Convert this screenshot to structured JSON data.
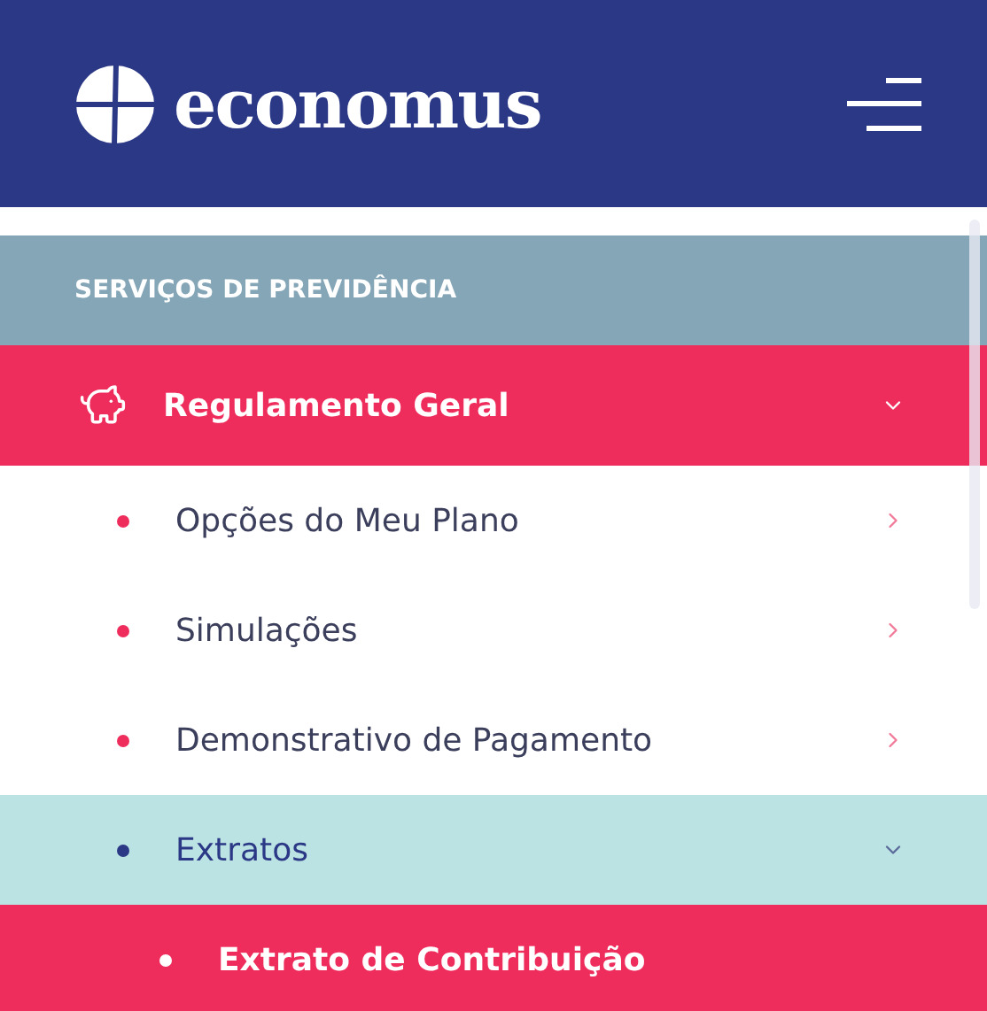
{
  "header": {
    "logo_text": "economus"
  },
  "menu": {
    "section_title": "SERVIÇOS DE PREVIDÊNCIA",
    "groups": [
      {
        "label": "Regulamento Geral",
        "expanded": true,
        "children": [
          {
            "label": "Opções do Meu Plano",
            "selected": false
          },
          {
            "label": "Simulações",
            "selected": false
          },
          {
            "label": "Demonstrativo de Pagamento",
            "selected": false
          },
          {
            "label": "Extratos",
            "expanded": true,
            "children": [
              {
                "label": "Extrato de Contribuição",
                "selected": true
              }
            ]
          }
        ]
      }
    ]
  }
}
